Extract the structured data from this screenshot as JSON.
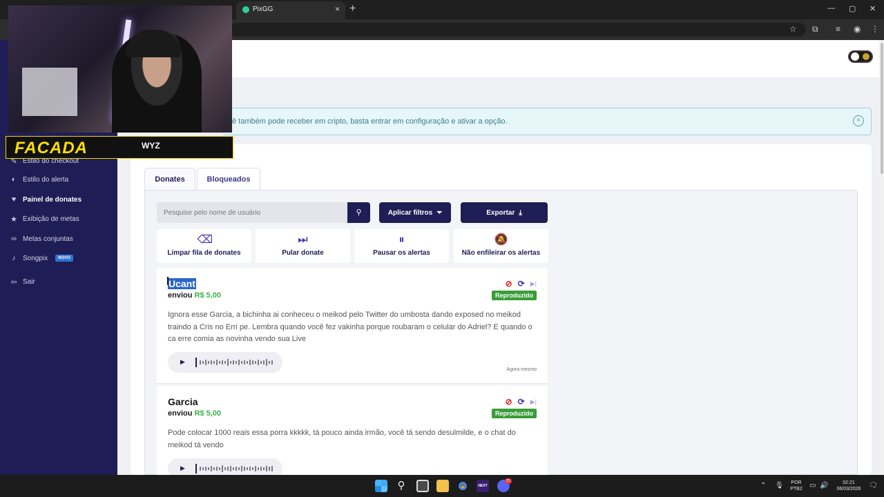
{
  "browser": {
    "tab_title": "PixGG",
    "tab_close": "×",
    "new_tab": "+",
    "window_controls": [
      "—",
      "▢",
      "✕"
    ],
    "toolbar_icons": [
      "star-icon",
      "extensions-icon",
      "media-icon",
      "profile-icon",
      "menu-icon"
    ]
  },
  "overlay": {
    "streamer_name": "FACADA",
    "logo_text": "WYZ"
  },
  "sidebar": {
    "items": [
      {
        "label": "Estilo do checkout",
        "icon": "palette-icon",
        "glyph": "✎"
      },
      {
        "label": "Estilo do alerta",
        "icon": "palette-icon",
        "glyph": "◐"
      },
      {
        "label": "Painel de donates",
        "icon": "donate-hand-icon",
        "glyph": "♥"
      },
      {
        "label": "Exibição de metas",
        "icon": "star-icon",
        "glyph": "★"
      },
      {
        "label": "Metas conjuntas",
        "icon": "link-icon",
        "glyph": "∞"
      },
      {
        "label": "Songpix",
        "icon": "music-icon",
        "glyph": "♪",
        "badge": "NOVO"
      },
      {
        "label": "Sair",
        "icon": "logout-icon",
        "glyph": "⇦"
      }
    ]
  },
  "info_banner": {
    "text": "ê também pode receber em cripto, basta entrar em configuração e ativar a opção.",
    "close": "×"
  },
  "tabs": [
    {
      "label": "Donates",
      "active": true
    },
    {
      "label": "Bloqueados",
      "active": false
    }
  ],
  "search": {
    "placeholder": "Pesquise pelo nome de usuário",
    "icon": "search-icon"
  },
  "buttons": {
    "filter_label": "Aplicar filtros",
    "export_label": "Exportar"
  },
  "actions": [
    {
      "label": "Limpar fila de donates",
      "icon": "eraser-icon",
      "glyph": "⌫"
    },
    {
      "label": "Pular donate",
      "icon": "skip-circle-icon",
      "glyph": "⏭"
    },
    {
      "label": "Pausar os alertas",
      "icon": "pause-circle-icon",
      "glyph": "⏸"
    },
    {
      "label": "Não enfileirar os alertas",
      "icon": "bell-off-icon",
      "glyph": "🔕"
    }
  ],
  "donates": [
    {
      "name": "Ucant",
      "sent_prefix": "enviou",
      "amount": "R$ 5,00",
      "status": "Reproduzido",
      "message": "Ignora esse Garcia, a bichinha ai conheceu o meikod pelo Twitter do umbosta dando exposed no meikod traindo a Cris no Erri pe. Lembra quando você fez vakinha porque roubaram o celular do Adriel? E quando o ca erre comia as novinha vendo sua Live",
      "time": "Agora mesmo"
    },
    {
      "name": "Garcia",
      "sent_prefix": "enviou",
      "amount": "R$ 5,00",
      "status": "Reproduzido",
      "message": "Pode colocar 1000 reais essa porra kkkkk, tá pouco ainda irmão, você tá sendo desulmilde, e o chat do meikod tá vendo"
    }
  ],
  "taskbar": {
    "language": "POR",
    "layout": "PTB2",
    "time": "02:21",
    "date": "06/03/2026",
    "discord_badge": "21",
    "next_label": "NEXT"
  },
  "colors": {
    "sidebar": "#1f1d55",
    "accent": "#4a2fb5",
    "amount": "#3bb34a",
    "status": "#3a9c3a",
    "blocked": "#dd2222"
  }
}
